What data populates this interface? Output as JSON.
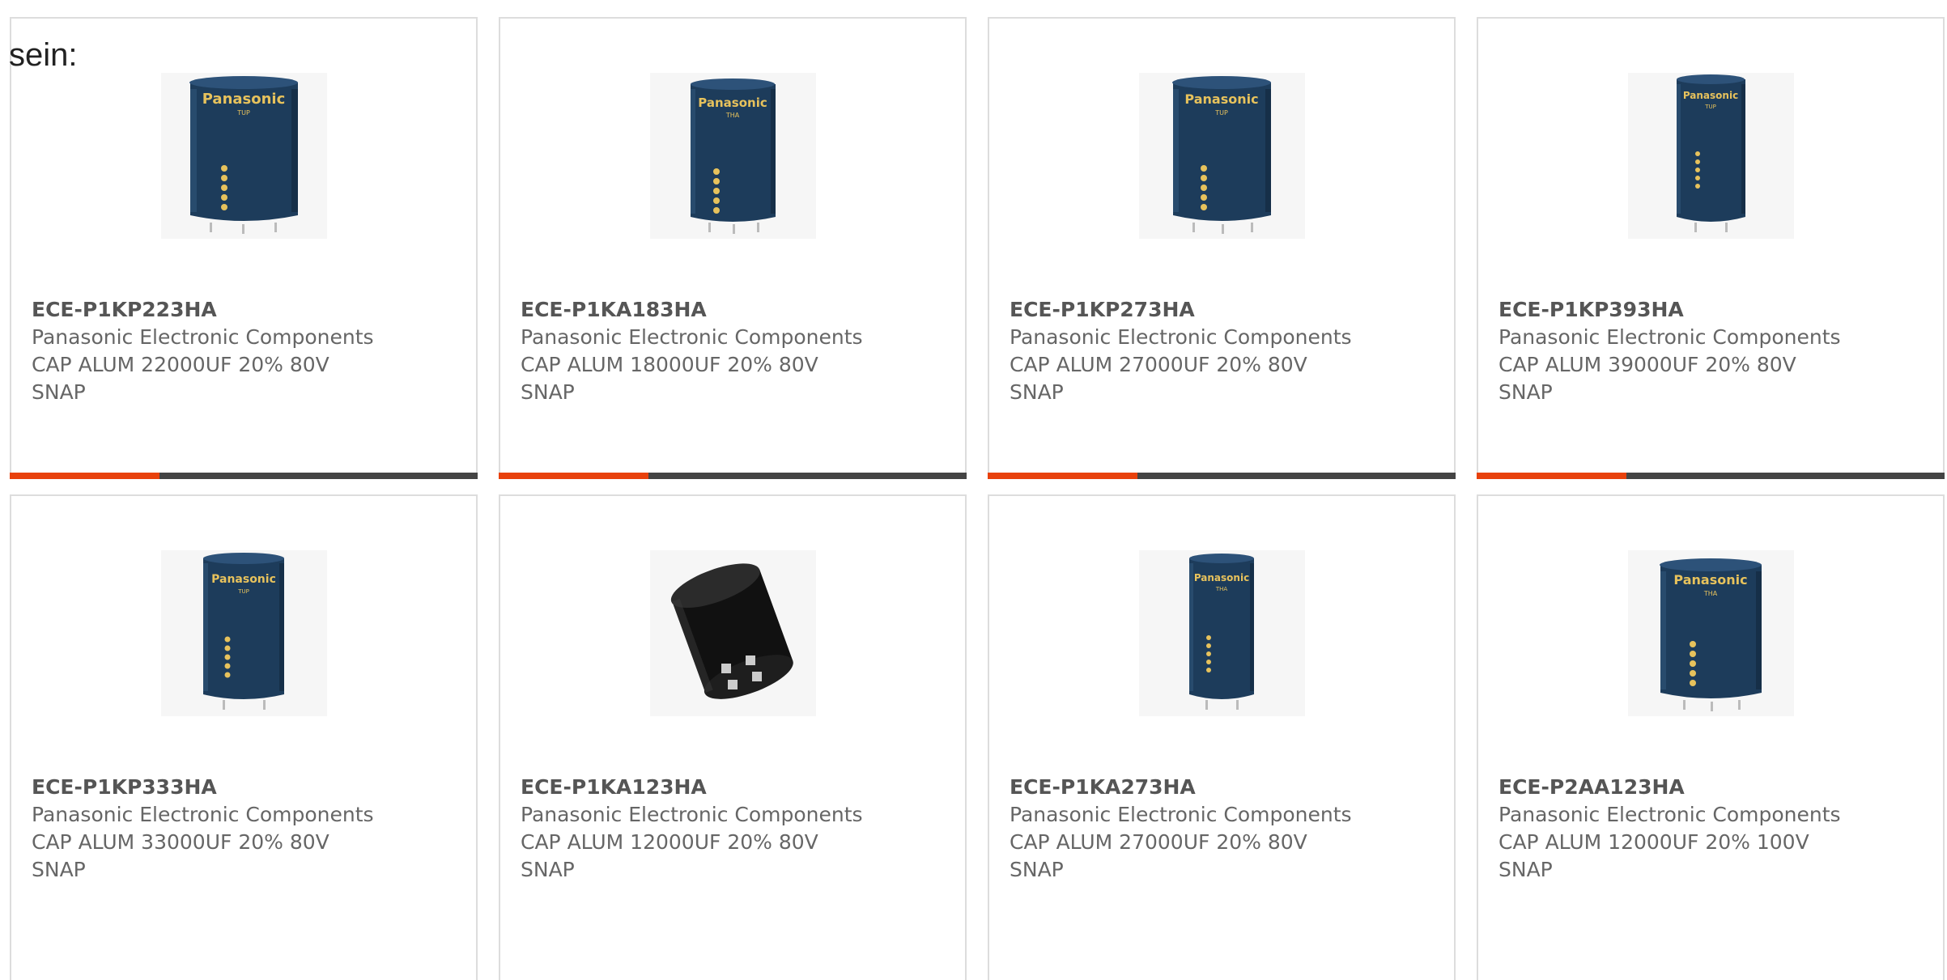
{
  "intro_text": "sein:",
  "colors": {
    "accent": "#e8410c",
    "bar_track": "#444444",
    "card_border": "#dddddd",
    "text_bold": "#555555",
    "text": "#666666"
  },
  "products": [
    {
      "part_number": "ECE-P1KP223HA",
      "manufacturer": "Panasonic Electronic Components",
      "description": "CAP ALUM 22000UF 20% 80V SNAP",
      "image": "panasonic-capacitor-image",
      "progress": 0.32
    },
    {
      "part_number": "ECE-P1KA183HA",
      "manufacturer": "Panasonic Electronic Components",
      "description": "CAP ALUM 18000UF 20% 80V SNAP",
      "image": "panasonic-capacitor-image",
      "progress": 0.32
    },
    {
      "part_number": "ECE-P1KP273HA",
      "manufacturer": "Panasonic Electronic Components",
      "description": "CAP ALUM 27000UF 20% 80V SNAP",
      "image": "panasonic-capacitor-image",
      "progress": 0.32
    },
    {
      "part_number": "ECE-P1KP393HA",
      "manufacturer": "Panasonic Electronic Components",
      "description": "CAP ALUM 39000UF 20% 80V SNAP",
      "image": "panasonic-capacitor-image",
      "progress": 0.32
    },
    {
      "part_number": "ECE-P1KP333HA",
      "manufacturer": "Panasonic Electronic Components",
      "description": "CAP ALUM 33000UF 20% 80V SNAP",
      "image": "panasonic-capacitor-image"
    },
    {
      "part_number": "ECE-P1KA123HA",
      "manufacturer": "Panasonic Electronic Components",
      "description": "CAP ALUM 12000UF 20% 80V SNAP",
      "image": "black-capacitor-image"
    },
    {
      "part_number": "ECE-P1KA273HA",
      "manufacturer": "Panasonic Electronic Components",
      "description": "CAP ALUM 27000UF 20% 80V SNAP",
      "image": "panasonic-capacitor-image"
    },
    {
      "part_number": "ECE-P2AA123HA",
      "manufacturer": "Panasonic Electronic Components",
      "description": "CAP ALUM 12000UF 20% 100V SNAP",
      "image": "panasonic-capacitor-image"
    }
  ]
}
